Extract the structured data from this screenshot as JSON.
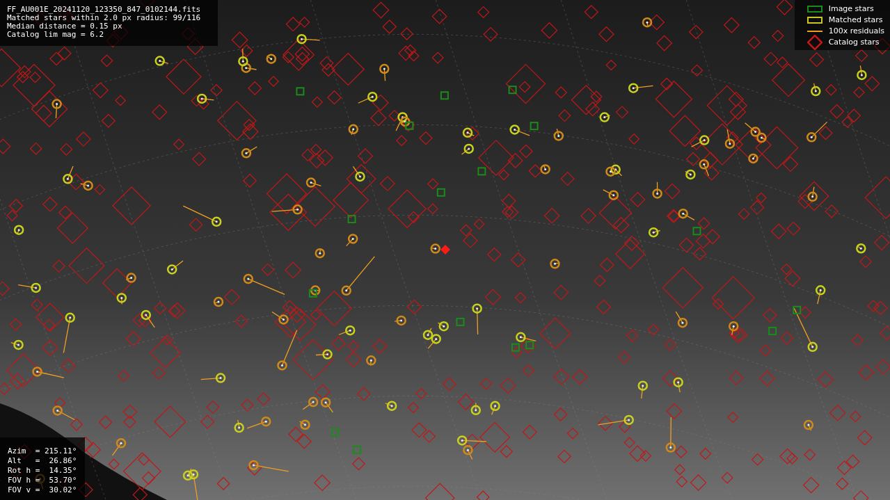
{
  "info": {
    "lines": [
      "FF_AU001E_20241120_123350_847_0102144.fits",
      "Matched stars within 2.0 px radius: 99/116",
      "Median distance = 0.15 px",
      "Catalog lim mag = 6.2"
    ]
  },
  "legend": [
    {
      "kind": "box",
      "color": "#1a8c1a",
      "label": "Image stars"
    },
    {
      "kind": "box",
      "color": "#c8c81e",
      "label": "Matched stars"
    },
    {
      "kind": "line",
      "color": "#f0a020",
      "label": "100x residuals"
    },
    {
      "kind": "diamond",
      "color": "#c01818",
      "label": "Catalog stars"
    }
  ],
  "pointing": {
    "lines": [
      "Azim  = 215.11°",
      "Alt   =  26.86°",
      "Rot h =  14.35°",
      "FOV h =  53.70°",
      "FOV v =  30.02°"
    ]
  }
}
